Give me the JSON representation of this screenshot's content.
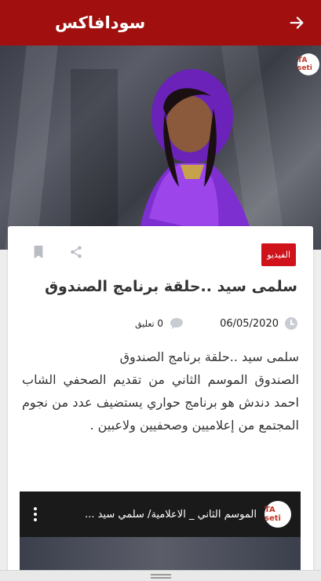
{
  "appbar": {
    "title": "سودافاكس",
    "back_icon": "arrow-right-icon",
    "color": "#a10f0f"
  },
  "hero": {
    "logo_text": "TA seti"
  },
  "article": {
    "category": "الفيديو",
    "title": "سلمى سيد ..حلقة برنامج الصندوق",
    "date": "06/05/2020",
    "comment_count": "0",
    "comment_label": "تعليق",
    "paragraphs": [
      "سلمى سيد ..حلقة برنامج الصندوق",
      "الصندوق الموسم الثاني من تقديم الصحفي الشاب احمد دندش هو برنامج حواري يستضيف عدد من نجوم المجتمع من إعلاميين وصحفيين ولاعبين ."
    ]
  },
  "video": {
    "title": "الموسم الثاني _ الاعلامية/ سلمي سيد ...",
    "logo_text": "TA seti"
  },
  "accent": "#d0121b"
}
